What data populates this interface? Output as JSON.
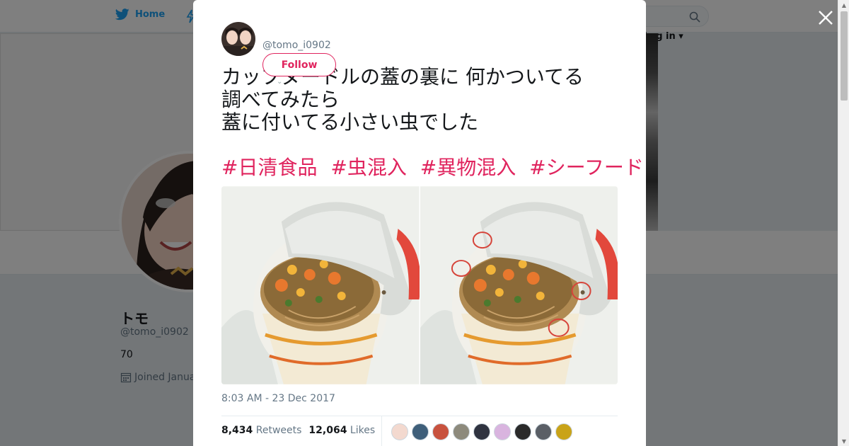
{
  "topbar": {
    "home_label": "Home",
    "login_label": "Log in"
  },
  "profile": {
    "name": "トモ",
    "handle": "@tomo_i0902",
    "count": "70",
    "joined": "Joined Janua"
  },
  "tweet": {
    "handle": "@tomo_i0902",
    "follow_label": "Follow",
    "text": "カップヌードルの蓋の裏に 何かついてる\n調べてみたら\n蓋に付いてる小さい虫でした",
    "hashtags": [
      "#日清食品",
      "#虫混入",
      "#異物混入",
      "#シーフード"
    ],
    "timestamp": "8:03 AM - 23 Dec 2017",
    "retweets_count": "8,434",
    "retweets_label": "Retweets",
    "likes_count": "12,064",
    "likes_label": "Likes"
  },
  "icons": {
    "twitter": "twitter-bird-icon",
    "moments": "moments-lightning-icon",
    "search": "search-icon",
    "close": "close-icon",
    "calendar": "calendar-icon"
  },
  "colors": {
    "brand": "#1da1f2",
    "accent": "#e0245e",
    "overlay": "rgba(0,0,0,0.5)"
  },
  "likers": [
    {
      "color": "#f3d9cf"
    },
    {
      "color": "#3f5f7a"
    },
    {
      "color": "#c8523e"
    },
    {
      "color": "#8d8a7c"
    },
    {
      "color": "#2f3340"
    },
    {
      "color": "#d9b4df"
    },
    {
      "color": "#2a2a2a"
    },
    {
      "color": "#5a5f66"
    },
    {
      "color": "#c9a318"
    }
  ]
}
